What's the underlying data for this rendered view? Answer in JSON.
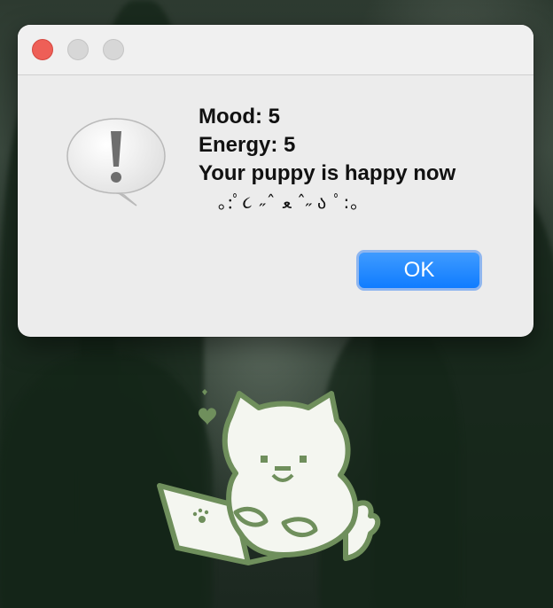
{
  "dialog": {
    "icon": "caution-speech-bubble-icon",
    "window_controls": [
      "close-button",
      "minimize-button",
      "zoom-button"
    ],
    "message_lines": [
      "Mood: 5",
      "Energy: 5",
      "Your puppy is happy now"
    ],
    "kaomoji": "｡:ﾟ૮ ˶ˆ ﻌ ˆ˶ ა ﾟ:｡",
    "ok_label": "OK"
  },
  "colors": {
    "close_button": "#ee5f57",
    "inactive_button": "#d7d7d7",
    "ok_button": "#0f7cff",
    "pet_outline": "#6f8f5c",
    "pet_fill": "#f4f6f0"
  },
  "desktop": {
    "pet": "white-fluffy-puppy-with-laptop",
    "hearts": "heart-icons"
  }
}
